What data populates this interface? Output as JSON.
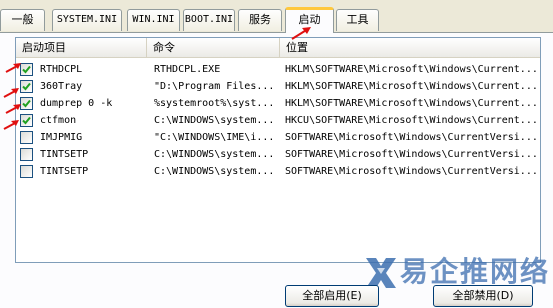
{
  "tabs": [
    {
      "label": "一般"
    },
    {
      "label": "SYSTEM.INI"
    },
    {
      "label": "WIN.INI"
    },
    {
      "label": "BOOT.INI"
    },
    {
      "label": "服务"
    },
    {
      "label": "启动",
      "active": true
    },
    {
      "label": "工具"
    }
  ],
  "columns": {
    "item": "启动项目",
    "command": "命令",
    "location": "位置"
  },
  "startup_items": [
    {
      "checked": true,
      "item": "RTHDCPL",
      "command": "RTHDCPL.EXE",
      "location": "HKLM\\SOFTWARE\\Microsoft\\Windows\\Current..."
    },
    {
      "checked": true,
      "item": "360Tray",
      "command": "\"D:\\Program Files...",
      "location": "HKLM\\SOFTWARE\\Microsoft\\Windows\\Current..."
    },
    {
      "checked": true,
      "item": "dumprep 0 -k",
      "command": "%systemroot%\\syst...",
      "location": "HKLM\\SOFTWARE\\Microsoft\\Windows\\Current..."
    },
    {
      "checked": true,
      "item": "ctfmon",
      "command": "C:\\WINDOWS\\system...",
      "location": "HKCU\\SOFTWARE\\Microsoft\\Windows\\Current..."
    },
    {
      "checked": false,
      "item": "IMJPMIG",
      "command": "\"C:\\WINDOWS\\IME\\i...",
      "location": "SOFTWARE\\Microsoft\\Windows\\CurrentVersi..."
    },
    {
      "checked": false,
      "item": "TINTSETP",
      "command": "C:\\WINDOWS\\system...",
      "location": "SOFTWARE\\Microsoft\\Windows\\CurrentVersi..."
    },
    {
      "checked": false,
      "item": "TINTSETP",
      "command": "C:\\WINDOWS\\system...",
      "location": "SOFTWARE\\Microsoft\\Windows\\CurrentVersi..."
    }
  ],
  "buttons": {
    "enable_all": "全部启用(E)",
    "disable_all": "全部禁用(D)"
  },
  "watermark": {
    "text": "易企推网络"
  },
  "colors": {
    "annotation": "#e01010",
    "tab_highlight": "#ffc83c",
    "check": "#21a121",
    "watermark": "#3c6eaf"
  },
  "icons": {
    "checkbox_checked": "checkmark-icon",
    "watermark_logo": "x-logo-icon",
    "annotation": "red-arrow-icon"
  }
}
